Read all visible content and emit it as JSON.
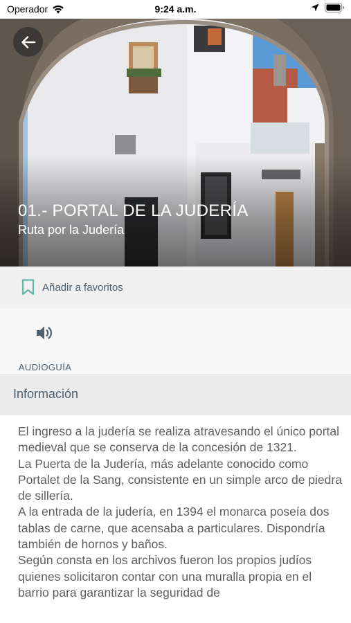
{
  "status_bar": {
    "carrier": "Operador",
    "time": "9:24 a.m."
  },
  "hero": {
    "title": "01.- PORTAL DE LA JUDERÍA",
    "subtitle": "Ruta por la Judería"
  },
  "favorites": {
    "label": "Añadir a favoritos"
  },
  "audio": {
    "label": "AUDIOGUÍA"
  },
  "info": {
    "title": "Información",
    "paragraphs": [
      "El ingreso a la judería se realiza atravesando el único portal medieval que se conserva de la concesión de 1321.",
      "La Puerta de la Judería, más adelante conocido como Portalet de la Sang, consistente en un simple arco de piedra de sillería.",
      "A la entrada de la judería, en 1394 el monarca poseía dos tablas de carne, que acensaba a particulares. Dispondría también de hornos y baños.",
      "Según consta en los archivos fueron los propios judíos quienes solicitaron contar con una muralla propia en el barrio para garantizar la seguridad de"
    ]
  },
  "colors": {
    "accent_teal": "#5fb8a6",
    "muted_blue_gray": "#4a6070",
    "body_text": "#5e5e5e"
  },
  "icons": [
    "wifi-icon",
    "location-arrow-icon",
    "battery-icon",
    "back-arrow-icon",
    "bookmark-icon",
    "speaker-icon"
  ]
}
